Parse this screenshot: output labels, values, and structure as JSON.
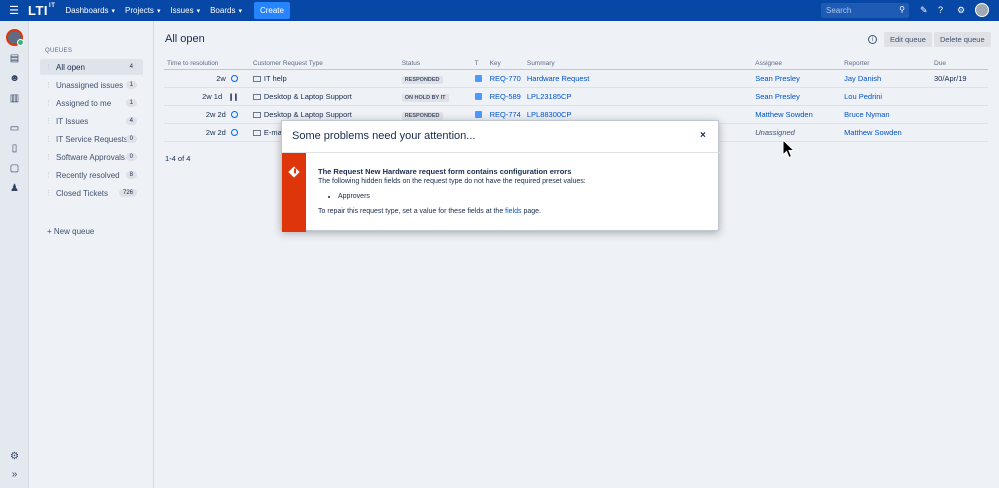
{
  "topnav": {
    "logo": "LTI",
    "logo_sup": "IT",
    "items": [
      "Dashboards",
      "Projects",
      "Issues",
      "Boards"
    ],
    "create_label": "Create",
    "search_placeholder": "Search"
  },
  "queues": {
    "heading": "QUEUES",
    "items": [
      {
        "label": "All open",
        "count": "4"
      },
      {
        "label": "Unassigned issues",
        "count": "1"
      },
      {
        "label": "Assigned to me",
        "count": "1"
      },
      {
        "label": "IT Issues",
        "count": "4"
      },
      {
        "label": "IT Service Requests",
        "count": "0"
      },
      {
        "label": "Software Approvals",
        "count": "0"
      },
      {
        "label": "Recently resolved",
        "count": "8"
      },
      {
        "label": "Closed Tickets",
        "count": "726"
      }
    ],
    "new_queue": "+ New queue"
  },
  "main": {
    "title": "All open",
    "edit_queue": "Edit queue",
    "delete_queue": "Delete queue",
    "columns": [
      "Time to resolution",
      "Customer Request Type",
      "Status",
      "T",
      "Key",
      "Summary",
      "Assignee",
      "Reporter",
      "Due"
    ],
    "rows": [
      {
        "ttr": "2w",
        "type": "IT help",
        "status": "RESPONDED",
        "key": "REQ-770",
        "summary": "Hardware Request",
        "assignee": "Sean Presley",
        "reporter": "Jay Danish",
        "due": "30/Apr/19"
      },
      {
        "ttr": "2w 1d",
        "type": "Desktop & Laptop Support",
        "status": "ON HOLD BY IT",
        "key": "REQ-589",
        "summary": "LPL23185CP",
        "assignee": "Sean Presley",
        "reporter": "Lou Pedrini",
        "due": ""
      },
      {
        "ttr": "2w 2d",
        "type": "Desktop & Laptop Support",
        "status": "RESPONDED",
        "key": "REQ-774",
        "summary": "LPL88300CP",
        "assignee": "Matthew Sowden",
        "reporter": "Bruce Nyman",
        "due": ""
      },
      {
        "ttr": "2w 2d",
        "type": "E-ma",
        "status": "",
        "key": "",
        "summary": "",
        "assignee": "Unassigned",
        "reporter": "Matthew Sowden",
        "due": ""
      }
    ],
    "pager": "1-4 of 4"
  },
  "modal": {
    "title": "Some problems need your attention...",
    "close": "×",
    "error_title": "The Request New Hardware request form contains configuration errors",
    "error_desc": "The following hidden fields on the request type do not have the required preset values:",
    "fields": [
      "Approvers"
    ],
    "repair_prefix": "To repair this request type, set a value for these fields at the ",
    "repair_link": "fields",
    "repair_suffix": " page."
  },
  "colors": {
    "nav": "#0747a6",
    "error": "#de350b",
    "link": "#0052cc"
  }
}
